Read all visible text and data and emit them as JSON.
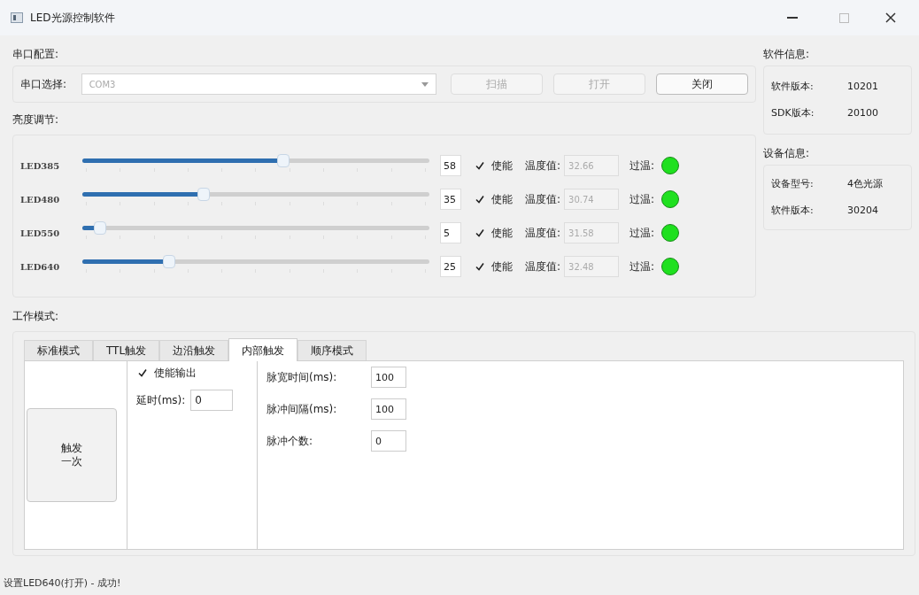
{
  "window": {
    "title": "LED光源控制软件"
  },
  "serial": {
    "heading": "串口配置:",
    "label": "串口选择:",
    "port": "COM3",
    "buttons": [
      {
        "label": "扫描",
        "disabled": true
      },
      {
        "label": "打开",
        "disabled": true
      },
      {
        "label": "关闭",
        "disabled": false
      }
    ]
  },
  "brightness": {
    "heading": "亮度调节:",
    "channels": [
      {
        "name": "LED385",
        "level": 0.58,
        "value": "58",
        "enabled": true,
        "enable_label": "使能",
        "temp_label": "温度值:",
        "temp": "32.66",
        "overheat_label": "过温:",
        "overheat": false
      },
      {
        "name": "LED480",
        "level": 0.35,
        "value": "35",
        "enabled": true,
        "enable_label": "使能",
        "temp_label": "温度值:",
        "temp": "30.74",
        "overheat_label": "过温:",
        "overheat": false
      },
      {
        "name": "LED550",
        "level": 0.05,
        "value": "5",
        "enabled": true,
        "enable_label": "使能",
        "temp_label": "温度值:",
        "temp": "31.58",
        "overheat_label": "过温:",
        "overheat": false
      },
      {
        "name": "LED640",
        "level": 0.25,
        "value": "25",
        "enabled": true,
        "enable_label": "使能",
        "temp_label": "温度值:",
        "temp": "32.48",
        "overheat_label": "过温:",
        "overheat": false
      }
    ]
  },
  "software_info": {
    "heading": "软件信息:",
    "rows": [
      {
        "label": "软件版本:",
        "value": "10201"
      },
      {
        "label": "SDK版本:",
        "value": "20100"
      }
    ]
  },
  "device_info": {
    "heading": "设备信息:",
    "rows": [
      {
        "label": "设备型号:",
        "value": "4色光源"
      },
      {
        "label": "软件版本:",
        "value": "30204"
      }
    ]
  },
  "work_mode": {
    "heading": "工作模式:",
    "tabs": [
      {
        "label": "标准模式",
        "selected": false
      },
      {
        "label": "TTL触发",
        "selected": false
      },
      {
        "label": "边沿触发",
        "selected": false
      },
      {
        "label": "内部触发",
        "selected": true
      },
      {
        "label": "顺序模式",
        "selected": false
      }
    ],
    "trigger_button": "触发一次",
    "output": {
      "label": "使能输出",
      "checked": true,
      "delay_label": "延时(ms):",
      "delay": "0"
    },
    "params": [
      {
        "label": "脉宽时间(ms):",
        "value": "100"
      },
      {
        "label": "脉冲间隔(ms):",
        "value": "100"
      },
      {
        "label": "脉冲个数:",
        "value": "0"
      }
    ]
  },
  "status_bar": "设置LED640(打开) - 成功!"
}
